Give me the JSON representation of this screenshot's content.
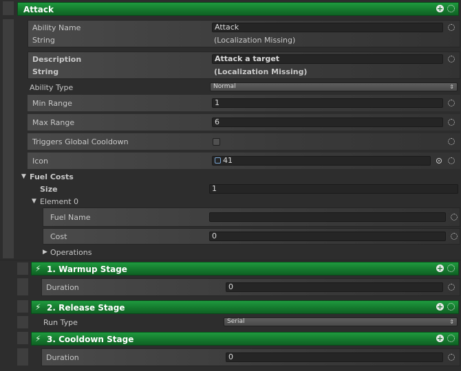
{
  "attack": {
    "header_title": "Attack",
    "ability_name": {
      "label": "Ability Name",
      "type_label": "String",
      "value": "Attack",
      "localized": "(Localization Missing)"
    },
    "description": {
      "label": "Description",
      "type_label": "String",
      "value": "Attack a target",
      "localized": "(Localization Missing)"
    },
    "ability_type": {
      "label": "Ability Type",
      "value": "Normal"
    },
    "min_range": {
      "label": "Min Range",
      "value": "1"
    },
    "max_range": {
      "label": "Max Range",
      "value": "6"
    },
    "triggers_gcd": {
      "label": "Triggers Global Cooldown",
      "checked": false
    },
    "icon": {
      "label": "Icon",
      "value": "41"
    },
    "fuel_costs": {
      "label": "Fuel Costs",
      "size_label": "Size",
      "size_value": "1",
      "element_label": "Element 0",
      "fuel_name_label": "Fuel Name",
      "fuel_name_value": "",
      "cost_label": "Cost",
      "cost_value": "0",
      "operations_label": "Operations"
    }
  },
  "stages": {
    "warmup": {
      "title": "1. Warmup Stage",
      "duration_label": "Duration",
      "duration_value": "0"
    },
    "release": {
      "title": "2. Release Stage",
      "run_type_label": "Run Type",
      "run_type_value": "Serial"
    },
    "cooldown": {
      "title": "3. Cooldown Stage",
      "duration_label": "Duration",
      "duration_value": "0"
    }
  },
  "icons": {
    "add": "plus-circle-icon",
    "options": "dotted-gear-icon",
    "stage": "lightning-bolt-icon",
    "picker": "object-picker-icon",
    "foldout": "triangle-icon"
  },
  "colors": {
    "header_green": "#157a2e",
    "background": "#2d2d2d",
    "field": "#252525"
  }
}
